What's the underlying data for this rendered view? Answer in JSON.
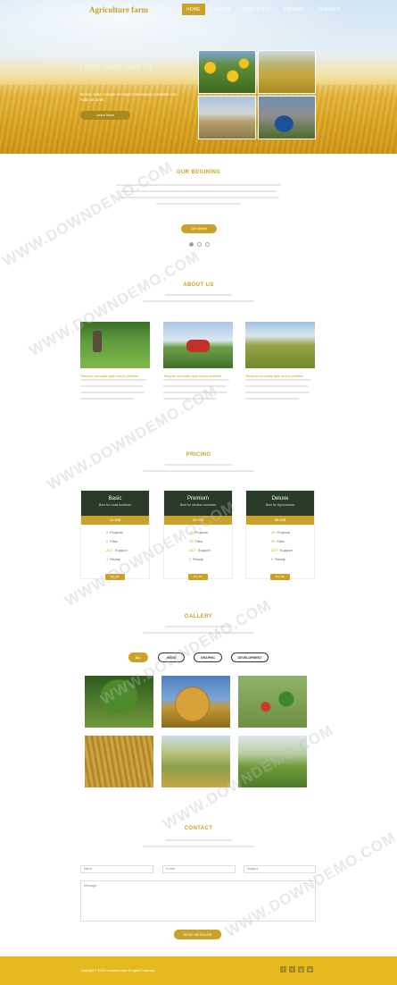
{
  "header": {
    "brand": "Agriculture farm",
    "nav": [
      "HOME",
      "ABOUT",
      "PORTFOLIO",
      "PRICING",
      "CONTACT"
    ]
  },
  "hero": {
    "title": "Lorem Ipsum Dolor Sit",
    "text": "Donec vitae congue vel eget malesuada Curabitur non nulla sit amet.",
    "button": "Learn More"
  },
  "beginning": {
    "title": "OUR BEGINING",
    "button": "Get Better"
  },
  "about": {
    "title": "ABOUT US",
    "captions": [
      "Tempus convallis quis lectus porttitor",
      "Tempus convallis quis lectus porttitor",
      "Tempus convallis quis lectus porttitor"
    ]
  },
  "pricing": {
    "title": "PRICING",
    "plans": [
      {
        "name": "Basic",
        "sub": "Best for small business",
        "price": "19.99$",
        "features": [
          "Projects",
          "Files",
          "Support",
          "Ready"
        ],
        "button": "Buy Me"
      },
      {
        "name": "Premium",
        "sub": "Best for medium business",
        "price": "49.99$",
        "features": [
          "Projects",
          "Files",
          "Support",
          "Ready"
        ],
        "button": "Buy Me"
      },
      {
        "name": "Deluxe",
        "sub": "Best for big business",
        "price": "99.99$",
        "features": [
          "Projects",
          "Files",
          "Support",
          "Ready"
        ],
        "button": "Buy Me"
      }
    ]
  },
  "gallery": {
    "title": "GALLERY",
    "filters": [
      "ALL",
      "WEBS",
      "GRAPHIC",
      "DEVELOPMENT"
    ]
  },
  "contact": {
    "title": "CONTACT",
    "name_placeholder": "Name",
    "email_placeholder": "E-mail",
    "subject_placeholder": "Subject",
    "message_placeholder": "Message",
    "button": "SEND MESSAGE"
  },
  "footer": {
    "text": "Copyright © 2016 Company name All rights Reserved",
    "social": [
      "f",
      "t",
      "g",
      "in"
    ]
  },
  "colors": {
    "accent": "#c9a227",
    "dark": "#2a3a28",
    "footer": "#e6b91e"
  }
}
